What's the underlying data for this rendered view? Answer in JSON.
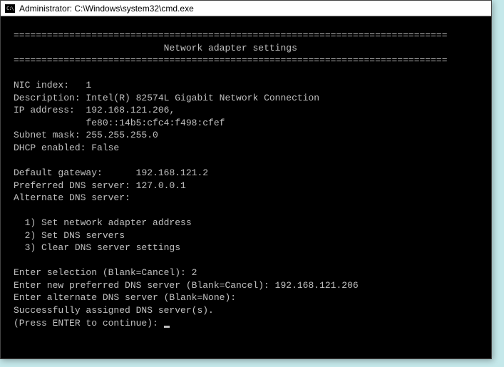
{
  "titlebar": {
    "icon_glyph": "C:\\",
    "text": "Administrator: C:\\Windows\\system32\\cmd.exe"
  },
  "header": {
    "divider": "==============================================================================",
    "title": "Network adapter settings"
  },
  "fields": {
    "nic_index_label": "NIC index:   ",
    "nic_index": "1",
    "description_label": "Description: ",
    "description": "Intel(R) 82574L Gigabit Network Connection",
    "ip_label": "IP address:  ",
    "ip_line1": "192.168.121.206,",
    "ip_indent": "             ",
    "ip_line2": "fe80::14b5:cfc4:f498:cfef",
    "subnet_label": "Subnet mask: ",
    "subnet": "255.255.255.0",
    "dhcp_label": "DHCP enabled: ",
    "dhcp": "False",
    "gateway_label": "Default gateway:      ",
    "gateway": "192.168.121.2",
    "pref_dns_label": "Preferred DNS server: ",
    "pref_dns": "127.0.0.1",
    "alt_dns_label": "Alternate DNS server:",
    "alt_dns": ""
  },
  "menu": {
    "opt1": "  1) Set network adapter address",
    "opt2": "  2) Set DNS servers",
    "opt3": "  3) Clear DNS server settings"
  },
  "prompts": {
    "selection_label": "Enter selection (Blank=Cancel): ",
    "selection_value": "2",
    "pref_dns_label": "Enter new preferred DNS server (Blank=Cancel): ",
    "pref_dns_value": "192.168.121.206",
    "alt_dns_label": "Enter alternate DNS server (Blank=None):",
    "alt_dns_value": "",
    "result": "Successfully assigned DNS server(s).",
    "continue_label": "(Press ENTER to continue): "
  }
}
